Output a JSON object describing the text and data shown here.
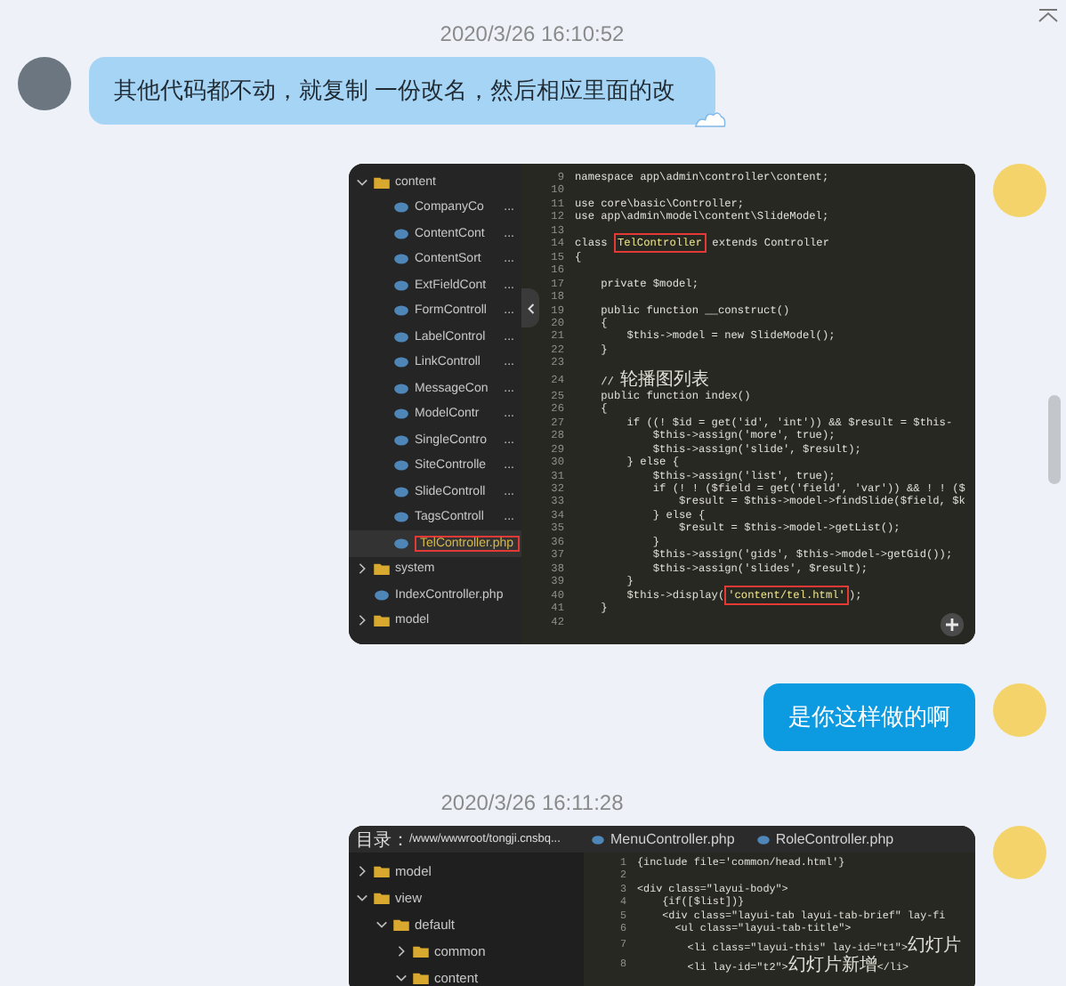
{
  "messages": [
    {
      "kind": "time",
      "text": "2020/3/26 16:10:52"
    },
    {
      "kind": "received",
      "text": "其他代码都不动，就复制 一份改名，然后相应里面的改"
    },
    {
      "kind": "screenshot",
      "tree": [
        {
          "kind": "folder",
          "name": "content",
          "expanded": true,
          "selected": false,
          "children": [
            {
              "kind": "file",
              "name": "CompanyCo",
              "suffix": "...",
              "selected": false
            },
            {
              "kind": "file",
              "name": "ContentCont",
              "suffix": "...",
              "selected": false
            },
            {
              "kind": "file",
              "name": "ContentSort",
              "suffix": "...",
              "selected": false
            },
            {
              "kind": "file",
              "name": "ExtFieldCont",
              "suffix": "...",
              "selected": false
            },
            {
              "kind": "file",
              "name": "FormControll",
              "suffix": "...",
              "selected": false
            },
            {
              "kind": "file",
              "name": "LabelControl",
              "suffix": "...",
              "selected": false
            },
            {
              "kind": "file",
              "name": "LinkControll",
              "suffix": "...",
              "selected": false
            },
            {
              "kind": "file",
              "name": "MessageCon",
              "suffix": "...",
              "selected": false
            },
            {
              "kind": "file",
              "name": "ModelContr",
              "suffix": "...",
              "selected": false
            },
            {
              "kind": "file",
              "name": "SingleContro",
              "suffix": "...",
              "selected": false
            },
            {
              "kind": "file",
              "name": "SiteControlle",
              "suffix": "...",
              "selected": false
            },
            {
              "kind": "file",
              "name": "SlideControll",
              "suffix": "...",
              "selected": false
            },
            {
              "kind": "file",
              "name": "TagsControll",
              "suffix": "...",
              "selected": false
            },
            {
              "kind": "file",
              "name": "TelController.php",
              "selected": true
            }
          ]
        },
        {
          "kind": "folder",
          "name": "system",
          "expanded": false,
          "selected": false
        },
        {
          "kind": "file",
          "name": "IndexController.php",
          "selected": false
        },
        {
          "kind": "folder",
          "name": "model",
          "expanded": false,
          "selected": false
        }
      ],
      "code": [
        {
          "num": "9",
          "text": "namespace app\\admin\\controller\\content;"
        },
        {
          "num": "10"
        },
        {
          "num": "11",
          "text": "use core\\basic\\Controller;"
        },
        {
          "num": "12",
          "text": "use app\\admin\\model\\content\\SlideModel;"
        },
        {
          "num": "13"
        },
        {
          "num": "14",
          "text": "class ",
          "boxed": "TelController",
          "after": " extends Controller"
        },
        {
          "num": "15",
          "text": "{"
        },
        {
          "num": "16"
        },
        {
          "num": "17",
          "text": "    private $model;"
        },
        {
          "num": "18"
        },
        {
          "num": "19",
          "text": "    public function __construct()"
        },
        {
          "num": "20",
          "text": "    {"
        },
        {
          "num": "21",
          "text": "        $this->model = new SlideModel();"
        },
        {
          "num": "22",
          "text": "    }"
        },
        {
          "num": "23"
        },
        {
          "num": "24",
          "text": "    // ",
          "cjk": "轮播图列表"
        },
        {
          "num": "25",
          "text": "    public function index()"
        },
        {
          "num": "26",
          "text": "    {"
        },
        {
          "num": "27",
          "text": "        if ((! $id = get('id', 'int')) && $result = $this-"
        },
        {
          "num": "28",
          "text": "            $this->assign('more', true);"
        },
        {
          "num": "29",
          "text": "            $this->assign('slide', $result);"
        },
        {
          "num": "30",
          "text": "        } else {"
        },
        {
          "num": "31",
          "text": "            $this->assign('list', true);"
        },
        {
          "num": "32",
          "text": "            if (! ! ($field = get('field', 'var')) && ! ! ($"
        },
        {
          "num": "33",
          "text": "                $result = $this->model->findSlide($field, $k"
        },
        {
          "num": "34",
          "text": "            } else {"
        },
        {
          "num": "35",
          "text": "                $result = $this->model->getList();"
        },
        {
          "num": "36",
          "text": "            }"
        },
        {
          "num": "37",
          "text": "            $this->assign('gids', $this->model->getGid());"
        },
        {
          "num": "38",
          "text": "            $this->assign('slides', $result);"
        },
        {
          "num": "39",
          "text": "        }"
        },
        {
          "num": "40",
          "text": "        $this->display(",
          "boxed": "'content/tel.html'",
          "after": ");"
        },
        {
          "num": "41",
          "text": "    }"
        },
        {
          "num": "42"
        }
      ]
    },
    {
      "kind": "sent",
      "text": "是你这样做的啊"
    },
    {
      "kind": "time",
      "text": "2020/3/26 16:11:28"
    },
    {
      "kind": "screenshot",
      "path_label": "目录：",
      "path": "/www/wwwroot/tongji.cnsbq...",
      "tabs": [
        "MenuController.php",
        "RoleController.php"
      ],
      "tree": [
        {
          "kind": "folder",
          "name": "model",
          "expanded": false
        },
        {
          "kind": "folder",
          "name": "view",
          "expanded": true,
          "children": [
            {
              "kind": "folder",
              "name": "default",
              "expanded": true,
              "children": [
                {
                  "kind": "folder",
                  "name": "common",
                  "expanded": false
                },
                {
                  "kind": "folder",
                  "name": "content",
                  "expanded": true
                }
              ]
            }
          ]
        }
      ],
      "code": [
        {
          "num": "1",
          "text": "{include file='common/head.html'}"
        },
        {
          "num": "2"
        },
        {
          "num": "3",
          "text": "<div class=\"layui-body\">"
        },
        {
          "num": "4",
          "text": "    {if([$list])}"
        },
        {
          "num": "5",
          "text": "    <div class=\"layui-tab layui-tab-brief\" lay-fi"
        },
        {
          "num": "6",
          "text": "      <ul class=\"layui-tab-title\">"
        },
        {
          "num": "7",
          "text": "        <li class=\"layui-this\" lay-id=\"t1\">",
          "cjk": "幻灯片"
        },
        {
          "num": "8",
          "text": "        <li lay-id=\"t2\">",
          "cjk": "幻灯片新增",
          "after": "</li>"
        }
      ]
    }
  ]
}
